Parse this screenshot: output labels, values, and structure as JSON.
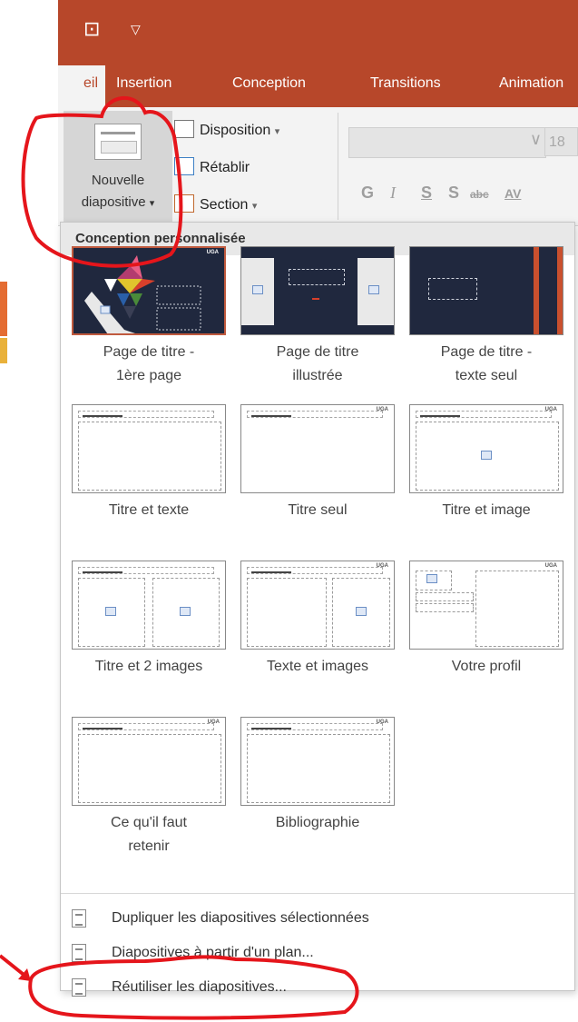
{
  "ribbon": {
    "tabs": [
      {
        "label": "eil",
        "active": true
      },
      {
        "label": "Insertion",
        "active": false
      },
      {
        "label": "Conception",
        "active": false
      },
      {
        "label": "Transitions",
        "active": false
      },
      {
        "label": "Animation",
        "active": false
      }
    ],
    "new_slide_line1": "Nouvelle",
    "new_slide_line2": "diapositive",
    "chevron": "▾",
    "disposition": "Disposition",
    "retablir": "Rétablir",
    "section": "Section",
    "font_size": "18",
    "format_buttons": [
      "G",
      "I",
      "S",
      "S"
    ]
  },
  "menu": {
    "header": "Conception personnalisée",
    "layouts": [
      {
        "cap1": "Page de titre -",
        "cap2": "1ère page"
      },
      {
        "cap1": "Page de titre",
        "cap2": "illustrée"
      },
      {
        "cap1": "Page de titre -",
        "cap2": "texte seul"
      },
      {
        "cap1": "Titre et texte",
        "cap2": ""
      },
      {
        "cap1": "Titre seul",
        "cap2": ""
      },
      {
        "cap1": "Titre et image",
        "cap2": ""
      },
      {
        "cap1": "Titre et 2 images",
        "cap2": ""
      },
      {
        "cap1": "Texte et images",
        "cap2": ""
      },
      {
        "cap1": "Votre profil",
        "cap2": ""
      },
      {
        "cap1": "Ce qu'il faut",
        "cap2": "retenir"
      },
      {
        "cap1": "Bibliographie",
        "cap2": ""
      }
    ],
    "logo_text": "UGA",
    "actions": [
      "Dupliquer les diapositives sélectionnées",
      "Diapositives à partir d'un plan...",
      "Réutiliser les diapositives..."
    ]
  },
  "colors": {
    "accent": "#b7472a",
    "annotation": "#e5151b"
  }
}
